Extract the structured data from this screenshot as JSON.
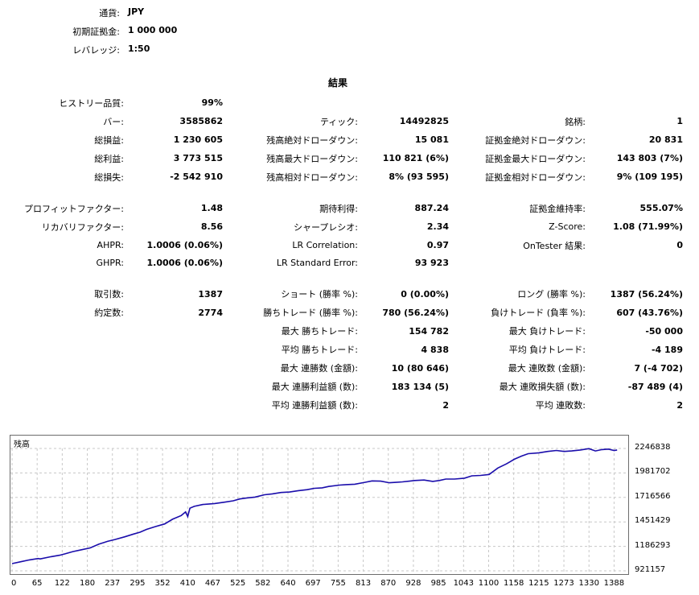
{
  "settings": {
    "currency_label": "通貨:",
    "currency_value": "JPY",
    "deposit_label": "初期証拠金:",
    "deposit_value": "1 000 000",
    "leverage_label": "レバレッジ:",
    "leverage_value": "1:50"
  },
  "section_title": "結果",
  "stats": {
    "history_quality_label": "ヒストリー品質:",
    "history_quality": "99%",
    "bars_label": "バー:",
    "bars": "3585862",
    "ticks_label": "ティック:",
    "ticks": "14492825",
    "symbols_label": "銘柄:",
    "symbols": "1",
    "net_profit_label": "総損益:",
    "net_profit": "1 230 605",
    "bal_dd_abs_label": "残高絶対ドローダウン:",
    "bal_dd_abs": "15 081",
    "eq_dd_abs_label": "証拠金絶対ドローダウン:",
    "eq_dd_abs": "20 831",
    "gross_profit_label": "総利益:",
    "gross_profit": "3 773 515",
    "bal_dd_max_label": "残高最大ドローダウン:",
    "bal_dd_max": "110 821 (6%)",
    "eq_dd_max_label": "証拠金最大ドローダウン:",
    "eq_dd_max": "143 803 (7%)",
    "gross_loss_label": "総損失:",
    "gross_loss": "-2 542 910",
    "bal_dd_rel_label": "残高相対ドローダウン:",
    "bal_dd_rel": "8% (93 595)",
    "eq_dd_rel_label": "証拠金相対ドローダウン:",
    "eq_dd_rel": "9% (109 195)",
    "profit_factor_label": "プロフィットファクター:",
    "profit_factor": "1.48",
    "expected_payoff_label": "期待利得:",
    "expected_payoff": "887.24",
    "margin_level_label": "証拠金維持率:",
    "margin_level": "555.07%",
    "recovery_factor_label": "リカバリファクター:",
    "recovery_factor": "8.56",
    "sharpe_label": "シャープレシオ:",
    "sharpe": "2.34",
    "zscore_label": "Z-Score:",
    "zscore": "1.08 (71.99%)",
    "ahpr_label": "AHPR:",
    "ahpr": "1.0006 (0.06%)",
    "lr_corr_label": "LR Correlation:",
    "lr_corr": "0.97",
    "ontester_label": "OnTester 結果:",
    "ontester": "0",
    "ghpr_label": "GHPR:",
    "ghpr": "1.0006 (0.06%)",
    "lr_stderr_label": "LR Standard Error:",
    "lr_stderr": "93 923",
    "trades_label": "取引数:",
    "trades": "1387",
    "short_label": "ショート (勝率 %):",
    "short": "0 (0.00%)",
    "long_label": "ロング (勝率 %):",
    "long": "1387 (56.24%)",
    "deals_label": "約定数:",
    "deals": "2774",
    "profit_trades_label": "勝ちトレード (勝率 %):",
    "profit_trades": "780 (56.24%)",
    "loss_trades_label": "負けトレード (負率 %):",
    "loss_trades": "607 (43.76%)",
    "largest_profit_label": "最大 勝ちトレード:",
    "largest_profit": "154 782",
    "largest_loss_label": "最大 負けトレード:",
    "largest_loss": "-50 000",
    "avg_profit_label": "平均 勝ちトレード:",
    "avg_profit": "4 838",
    "avg_loss_label": "平均 負けトレード:",
    "avg_loss": "-4 189",
    "max_cons_wins_label": "最大 連勝数 (金額):",
    "max_cons_wins": "10 (80 646)",
    "max_cons_losses_label": "最大 連敗数 (金額):",
    "max_cons_losses": "7 (-4 702)",
    "max_cons_profit_label": "最大 連勝利益額 (数):",
    "max_cons_profit": "183 134 (5)",
    "max_cons_loss_label": "最大 連敗損失額 (数):",
    "max_cons_loss": "-87 489 (4)",
    "avg_cons_wins_label": "平均 連勝利益額 (数):",
    "avg_cons_wins": "2",
    "avg_cons_losses_label": "平均 連敗数:",
    "avg_cons_losses": "2"
  },
  "chart_data": {
    "type": "line",
    "title": "残高",
    "xlabel": "",
    "ylabel": "",
    "x_ticks": [
      "0",
      "65",
      "122",
      "180",
      "237",
      "295",
      "352",
      "410",
      "467",
      "525",
      "582",
      "640",
      "697",
      "755",
      "813",
      "870",
      "928",
      "985",
      "1043",
      "1100",
      "1158",
      "1215",
      "1273",
      "1330",
      "1388"
    ],
    "y_ticks": [
      "2246838",
      "1981702",
      "1716566",
      "1451429",
      "1186293",
      "921157"
    ],
    "xlim": [
      0,
      1400
    ],
    "ylim": [
      921157,
      2246838
    ],
    "grid": true,
    "line_color": "#1a0dab",
    "series": [
      {
        "x": [
          0,
          20,
          40,
          60,
          65,
          90,
          110,
          122,
          140,
          160,
          180,
          200,
          220,
          237,
          260,
          280,
          295,
          310,
          330,
          352,
          370,
          390,
          400,
          405,
          410,
          420,
          440,
          467,
          490,
          510,
          525,
          540,
          560,
          582,
          600,
          620,
          640,
          660,
          680,
          697,
          715,
          730,
          755,
          770,
          790,
          813,
          830,
          850,
          870,
          885,
          900,
          928,
          950,
          970,
          985,
          1000,
          1020,
          1043,
          1060,
          1080,
          1100,
          1120,
          1140,
          1158,
          1175,
          1190,
          1215,
          1235,
          1255,
          1273,
          1290,
          1310,
          1330,
          1345,
          1360,
          1375,
          1388,
          1395
        ],
        "y": [
          1000000,
          1020000,
          1040000,
          1055000,
          1050000,
          1075000,
          1090000,
          1105000,
          1130000,
          1150000,
          1170000,
          1210000,
          1240000,
          1260000,
          1290000,
          1320000,
          1340000,
          1370000,
          1400000,
          1430000,
          1480000,
          1520000,
          1560000,
          1510000,
          1600000,
          1620000,
          1640000,
          1650000,
          1665000,
          1680000,
          1700000,
          1710000,
          1720000,
          1745000,
          1755000,
          1770000,
          1775000,
          1790000,
          1800000,
          1815000,
          1820000,
          1835000,
          1850000,
          1855000,
          1860000,
          1880000,
          1895000,
          1893000,
          1875000,
          1880000,
          1885000,
          1900000,
          1905000,
          1890000,
          1900000,
          1915000,
          1915000,
          1925000,
          1950000,
          1955000,
          1965000,
          2035000,
          2080000,
          2130000,
          2165000,
          2190000,
          2200000,
          2215000,
          2225000,
          2215000,
          2220000,
          2230000,
          2245000,
          2220000,
          2235000,
          2240000,
          2225000,
          2230000
        ]
      }
    ]
  }
}
